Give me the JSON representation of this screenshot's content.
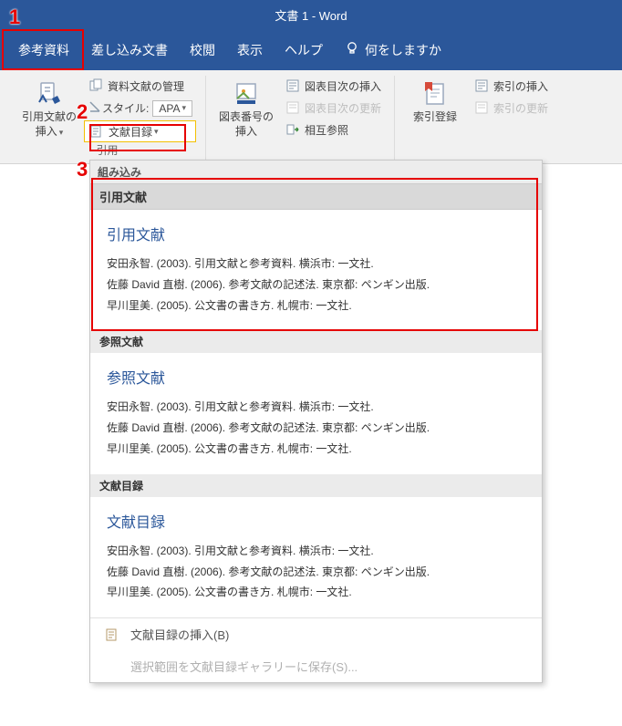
{
  "title": "文書 1  -  Word",
  "tabs": {
    "references": "参考資料",
    "mailings": "差し込み文書",
    "review": "校閲",
    "view": "表示",
    "help": "ヘルプ",
    "tellme": "何をしますか"
  },
  "ribbon": {
    "insert_citation": {
      "line1": "引用文献の",
      "line2": "挿入"
    },
    "manage_sources": "資料文献の管理",
    "style_label": "スタイル:",
    "style_value": "APA",
    "bibliography": "文献目録",
    "insert_caption": {
      "line1": "図表番号の",
      "line2": "挿入"
    },
    "insert_table_figures": "図表目次の挿入",
    "update_tof": "図表目次の更新",
    "cross_ref": "相互参照",
    "mark_entry": "索引登録",
    "insert_index": "索引の挿入",
    "update_index": "索引の更新",
    "truncated": "引用"
  },
  "gallery": {
    "built_in": "組み込み",
    "sections": [
      {
        "header": "引用文献",
        "title": "引用文献",
        "entries": [
          "安田永智. (2003). 引用文献と参考資料. 横浜市:  一文社.",
          "佐藤 David 直樹. (2006). 参考文献の記述法. 東京都: ペンギン出版.",
          "早川里美. (2005). 公文書の書き方. 札幌市:  一文社."
        ]
      },
      {
        "header": "参照文献",
        "title": "参照文献",
        "entries": [
          "安田永智. (2003). 引用文献と参考資料. 横浜市:  一文社.",
          "佐藤 David 直樹. (2006). 参考文献の記述法. 東京都: ペンギン出版.",
          "早川里美. (2005). 公文書の書き方. 札幌市:  一文社."
        ]
      },
      {
        "header": "文献目録",
        "title": "文献目録",
        "entries": [
          "安田永智. (2003). 引用文献と参考資料. 横浜市:  一文社.",
          "佐藤 David 直樹. (2006). 参考文献の記述法. 東京都: ペンギン出版.",
          "早川里美. (2005). 公文書の書き方. 札幌市:  一文社."
        ]
      }
    ],
    "insert_cmd": "文献目録の挿入(B)",
    "save_cmd": "選択範囲を文献目録ギャラリーに保存(S)..."
  },
  "annotations": {
    "n1": "1",
    "n2": "2",
    "n3": "3"
  }
}
